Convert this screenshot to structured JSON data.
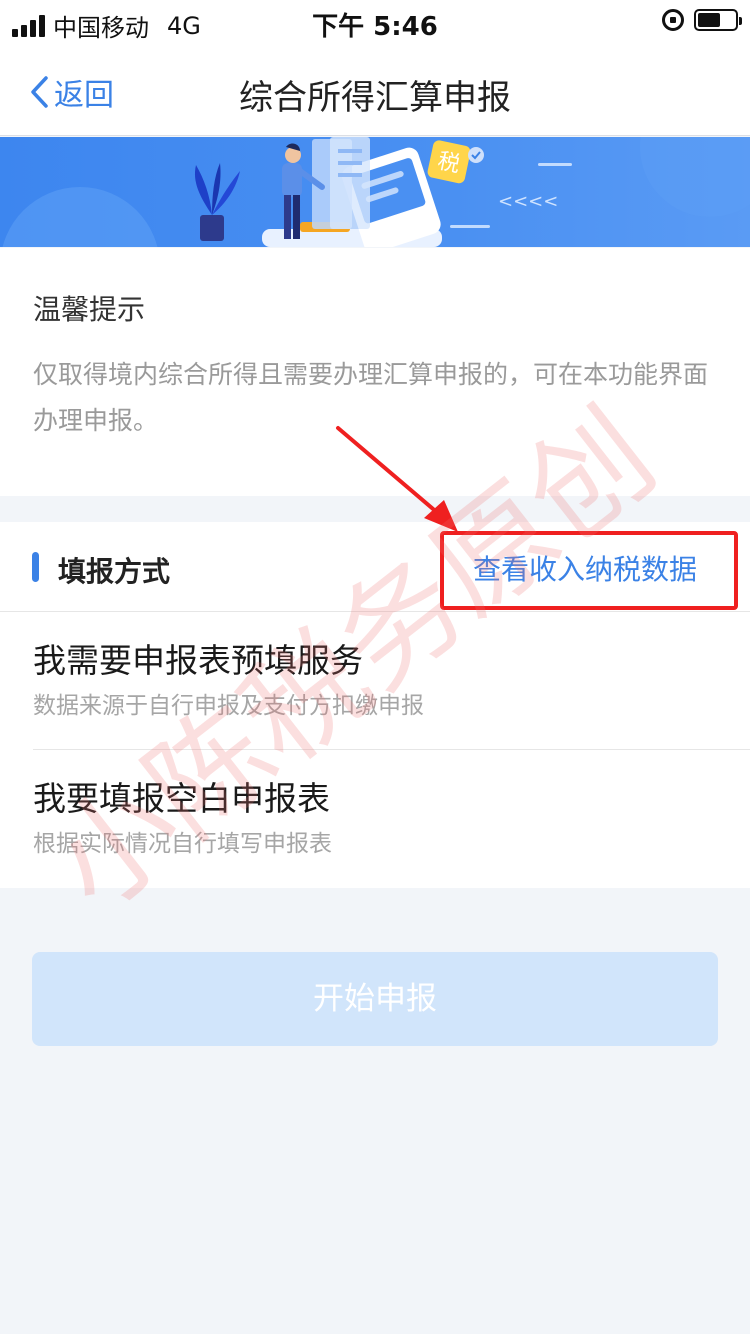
{
  "status_bar": {
    "carrier": "中国移动",
    "network": "4G",
    "time": "下午 5:46"
  },
  "nav": {
    "back_label": "返回",
    "title": "综合所得汇算申报"
  },
  "banner": {
    "tax_badge": "税",
    "arrows_text": "<<<<"
  },
  "notice": {
    "title": "温馨提示",
    "text": "仅取得境内综合所得且需要办理汇算申报的，可在本功能界面办理申报。"
  },
  "method": {
    "section_label": "填报方式",
    "view_data_link": "查看收入纳税数据",
    "options": [
      {
        "title": "我需要申报表预填服务",
        "subtitle": "数据来源于自行申报及支付方扣缴申报"
      },
      {
        "title": "我要填报空白申报表",
        "subtitle": "根据实际情况自行填写申报表"
      }
    ]
  },
  "start_button": "开始申报",
  "watermark": "小陈税务原创",
  "colors": {
    "accent": "#3b82e6",
    "annotation_red": "#ef2020",
    "page_bg": "#f2f5f9",
    "button_disabled_bg": "#d1e5fb"
  }
}
